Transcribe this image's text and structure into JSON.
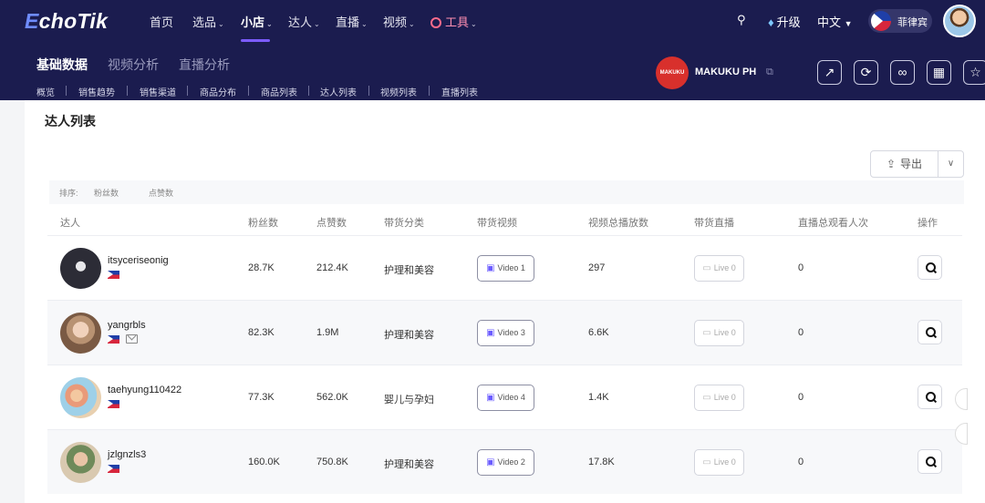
{
  "app": {
    "logo": "EchoTik"
  },
  "topnav": [
    {
      "label": "首页",
      "dropdown": false
    },
    {
      "label": "选品",
      "dropdown": true
    },
    {
      "label": "小店",
      "dropdown": true,
      "active": true
    },
    {
      "label": "达人",
      "dropdown": true
    },
    {
      "label": "直播",
      "dropdown": true
    },
    {
      "label": "视频",
      "dropdown": true
    },
    {
      "label": "工具",
      "dropdown": true
    }
  ],
  "header_right": {
    "upgrade": "升级",
    "language": "中文",
    "region": "菲律宾"
  },
  "subnav": {
    "tabs": [
      "基础数据",
      "视频分析",
      "直播分析"
    ],
    "links": [
      "概览",
      "销售趋势",
      "销售渠道",
      "商品分布",
      "商品列表",
      "达人列表",
      "视频列表",
      "直播列表"
    ]
  },
  "shop": {
    "name": "MAKUKU PH",
    "logo_text": "MAKUKU"
  },
  "section": {
    "title": "达人列表",
    "export": "导出"
  },
  "sort": {
    "label": "排序:",
    "options": [
      "粉丝数",
      "点赞数"
    ]
  },
  "table": {
    "headers": [
      "达人",
      "粉丝数",
      "点赞数",
      "带货分类",
      "带货视频",
      "视频总播放数",
      "带货直播",
      "直播总观看人次",
      "操作"
    ],
    "rows": [
      {
        "name": "itsyceriseonig",
        "followers": "28.7K",
        "likes": "212.4K",
        "category": "护理和美容",
        "videos": "Video 1",
        "plays": "297",
        "lives": "Live 0",
        "viewers": "0"
      },
      {
        "name": "yangrbls",
        "followers": "82.3K",
        "likes": "1.9M",
        "category": "护理和美容",
        "videos": "Video 3",
        "plays": "6.6K",
        "lives": "Live 0",
        "viewers": "0"
      },
      {
        "name": "taehyung110422",
        "followers": "77.3K",
        "likes": "562.0K",
        "category": "婴儿与孕妇",
        "videos": "Video 4",
        "plays": "1.4K",
        "lives": "Live 0",
        "viewers": "0"
      },
      {
        "name": "jzlgnzls3",
        "followers": "160.0K",
        "likes": "750.8K",
        "category": "护理和美容",
        "videos": "Video 2",
        "plays": "17.8K",
        "lives": "Live 0",
        "viewers": "0"
      }
    ]
  },
  "colors": {
    "nav_bg": "#1b1c4f",
    "accent": "#7c5cff",
    "shop_red": "#d8302c"
  }
}
